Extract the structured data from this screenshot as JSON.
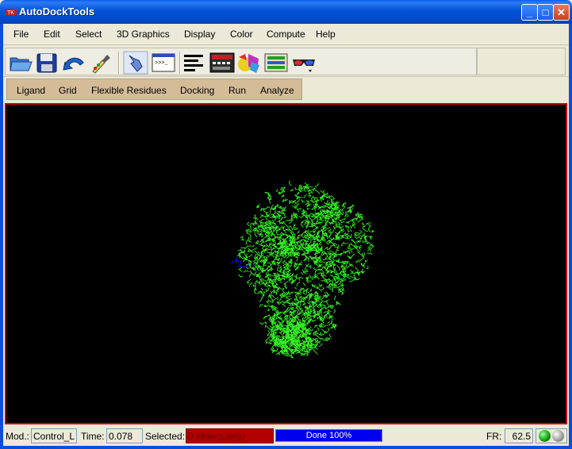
{
  "window": {
    "title": "AutoDockTools",
    "minimize_label": "_",
    "maximize_label": "□",
    "close_label": "✕"
  },
  "menubar": {
    "items": [
      {
        "label": "File"
      },
      {
        "label": "Edit"
      },
      {
        "label": "Select"
      },
      {
        "label": "3D Graphics"
      },
      {
        "label": "Display"
      },
      {
        "label": "Color"
      },
      {
        "label": "Compute"
      },
      {
        "label": "Help"
      }
    ]
  },
  "toolbar": {
    "icons": [
      "open-folder-icon",
      "save-disk-icon",
      "undo-arrow-icon",
      "pipette-icon",
      "hand-pick-icon",
      "python-shell-icon",
      "text-lines-icon",
      "dashboard-icon",
      "color-shapes-icon",
      "layers-panel-icon",
      "stereo-glasses-icon"
    ]
  },
  "adt_menu": {
    "items": [
      {
        "label": "Ligand"
      },
      {
        "label": "Grid"
      },
      {
        "label": "Flexible Residues"
      },
      {
        "label": "Docking"
      },
      {
        "label": "Run"
      },
      {
        "label": "Analyze"
      }
    ]
  },
  "viewer": {
    "molecule_color": "#33ee22",
    "axis_color": "#0000cc",
    "background_color": "#000000",
    "border_color": "#c00000"
  },
  "statusbar": {
    "mod_label": "Mod.:",
    "mod_value": "Control_L",
    "time_label": "Time:",
    "time_value": "0.078",
    "selected_label": "Selected:",
    "selected_value": "0 Molecule(s)",
    "progress_text": "Done 100%",
    "progress_fraction": 1.0,
    "fr_label": "FR:",
    "fr_value": "62.5"
  }
}
